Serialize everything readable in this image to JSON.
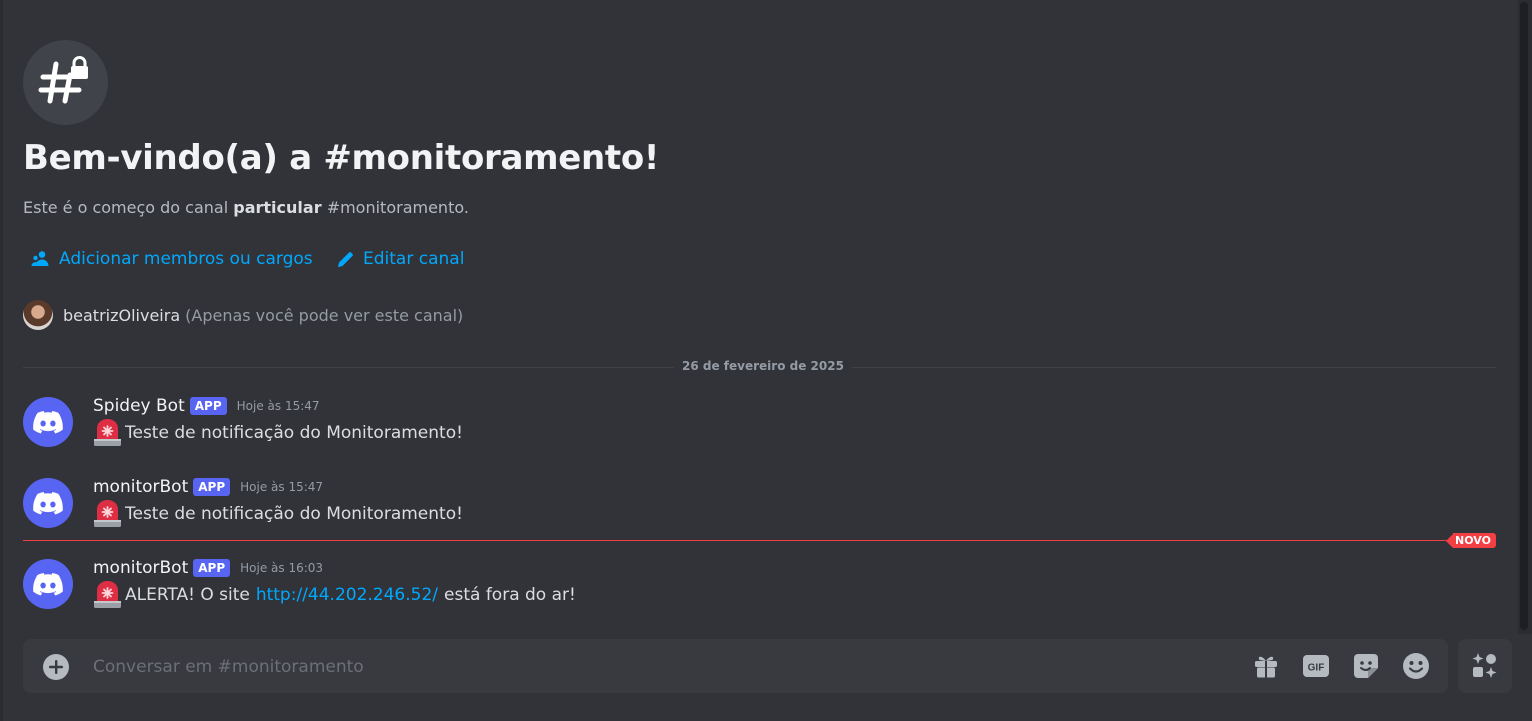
{
  "welcome": {
    "title": "Bem-vindo(a) a #monitoramento!",
    "desc_prefix": "Este é o começo do canal",
    "desc_bold": "particular",
    "desc_suffix": "#monitoramento."
  },
  "actions": {
    "add_members": "Adicionar membros ou cargos",
    "edit_channel": "Editar canal"
  },
  "owner": {
    "name": "beatrizOliveira",
    "note": "(Apenas você pode ver este canal)"
  },
  "date_divider": "26 de fevereiro de 2025",
  "messages": [
    {
      "author": "Spidey Bot",
      "tag": "APP",
      "timestamp": "Hoje às 15:47",
      "content": "Teste de notificação do Monitoramento!"
    },
    {
      "author": "monitorBot",
      "tag": "APP",
      "timestamp": "Hoje às 15:47",
      "content": "Teste de notificação do Monitoramento!"
    },
    {
      "author": "monitorBot",
      "tag": "APP",
      "timestamp": "Hoje às 16:03",
      "content_prefix": "ALERTA! O site",
      "link": "http://44.202.246.52/",
      "content_suffix": "está fora do ar!"
    }
  ],
  "new_badge": "NOVO",
  "composer": {
    "placeholder": "Conversar em #monitoramento",
    "gif_label": "GIF"
  },
  "icons": {
    "channel": "private-text-channel-icon",
    "add_members": "members-icon",
    "edit": "pencil-icon",
    "bot": "discord-logo-icon",
    "siren": "rotating-light-emoji",
    "attach": "plus-circle-icon",
    "gift": "gift-icon",
    "gif": "gif-icon",
    "sticker": "sticker-icon",
    "emoji": "emoji-icon",
    "apps": "apps-icon"
  },
  "colors": {
    "background": "#323339",
    "link": "#00a8fc",
    "brand": "#5865f2",
    "new_divider": "#f23f43"
  }
}
